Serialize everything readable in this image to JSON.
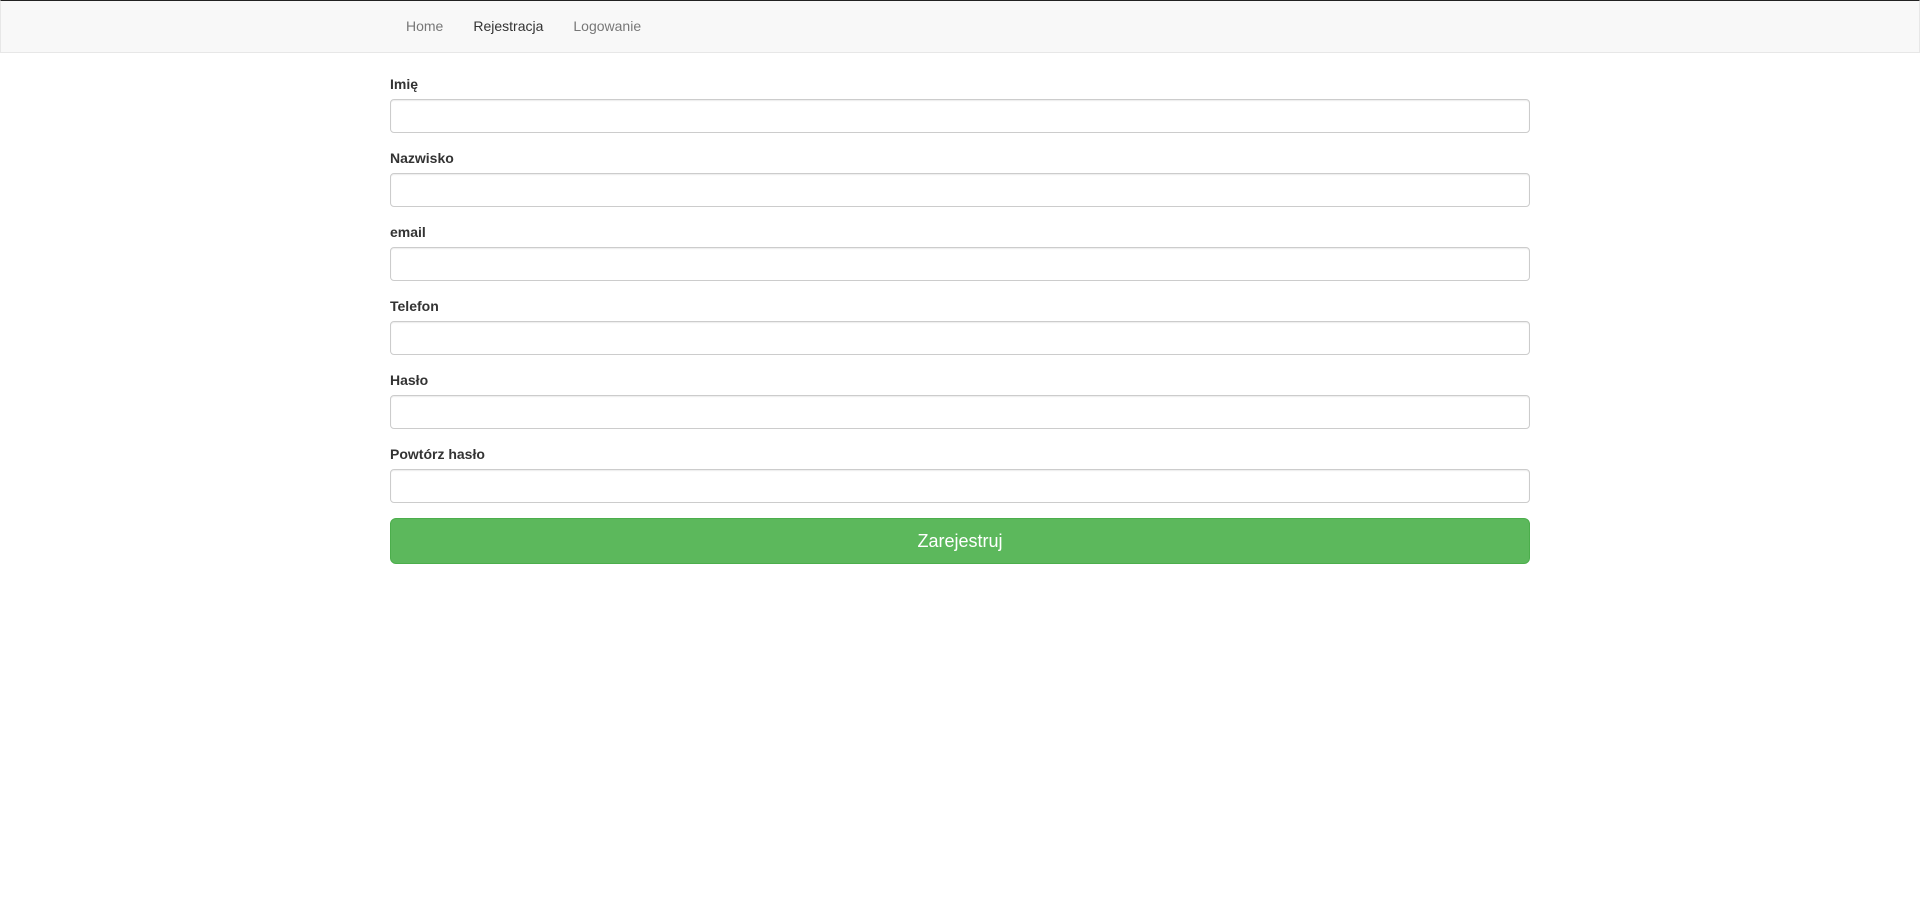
{
  "navbar": {
    "items": [
      {
        "label": "Home",
        "active": false
      },
      {
        "label": "Rejestracja",
        "active": true
      },
      {
        "label": "Logowanie",
        "active": false
      }
    ]
  },
  "form": {
    "fields": [
      {
        "label": "Imię",
        "value": "",
        "type": "text"
      },
      {
        "label": "Nazwisko",
        "value": "",
        "type": "text"
      },
      {
        "label": "email",
        "value": "",
        "type": "email"
      },
      {
        "label": "Telefon",
        "value": "",
        "type": "tel"
      },
      {
        "label": "Hasło",
        "value": "",
        "type": "password"
      },
      {
        "label": "Powtórz hasło",
        "value": "",
        "type": "password"
      }
    ],
    "submit_label": "Zarejestruj"
  },
  "colors": {
    "success": "#5cb85c",
    "navbar_bg": "#f8f8f8"
  }
}
